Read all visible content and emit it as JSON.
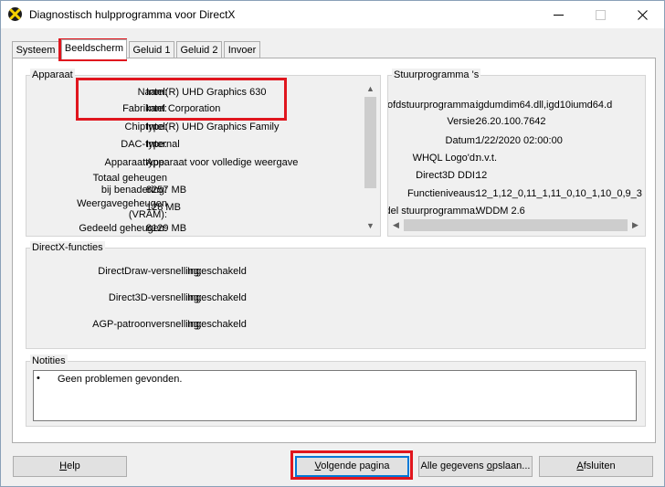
{
  "window": {
    "title": "Diagnostisch hulpprogramma voor DirectX",
    "icon": "directx-x-icon"
  },
  "tabs": [
    {
      "label": "Systeem",
      "active": false
    },
    {
      "label": "Beeldscherm",
      "active": true
    },
    {
      "label": "Geluid 1",
      "active": false
    },
    {
      "label": "Geluid 2",
      "active": false
    },
    {
      "label": "Invoer",
      "active": false
    }
  ],
  "device": {
    "title": "Apparaat",
    "rows": [
      {
        "label": "Naam:",
        "value": "Intel(R) UHD Graphics 630"
      },
      {
        "label": "Fabrikant:",
        "value": "Intel Corporation"
      },
      {
        "label": "Chiptype:",
        "value": "Intel(R) UHD Graphics Family"
      },
      {
        "label": "DAC-type:",
        "value": "Internal"
      },
      {
        "label": "Apparaattype:",
        "value": "Apparaat voor volledige weergave"
      },
      {
        "label_lines": [
          "Totaal geheugen",
          "bij benadering:"
        ],
        "value": "8257 MB"
      },
      {
        "label_lines": [
          "Weergavegeheugen",
          "(VRAM):"
        ],
        "value": "128 MB"
      },
      {
        "label": "Gedeeld geheugen:",
        "value": "8129 MB"
      }
    ]
  },
  "drivers": {
    "title": "Stuurprogramma 's",
    "rows": [
      {
        "label": "Hoofdstuurprogramma:",
        "value": "igdumdim64.dll,igd10iumd64.d"
      },
      {
        "label": "Versie:",
        "value": "26.20.100.7642"
      },
      {
        "label": "Datum:",
        "value": "1/22/2020 02:00:00"
      },
      {
        "label": "WHQL Logo'd:",
        "value": "n.v.t."
      },
      {
        "label": "Direct3D DDI:",
        "value": "12"
      },
      {
        "label": "Functieniveaus:",
        "value": "12_1,12_0,11_1,11_0,10_1,10_0,9_3"
      },
      {
        "label": "Model stuurprogramma:",
        "value": "WDDM 2.6"
      }
    ]
  },
  "directx": {
    "title": "DirectX-functies",
    "rows": [
      {
        "label": "DirectDraw-versnelling:",
        "value": "Ingeschakeld"
      },
      {
        "label": "Direct3D-versnelling:",
        "value": "Ingeschakeld"
      },
      {
        "label": "AGP-patroonversnelling:",
        "value": "Ingeschakeld"
      }
    ]
  },
  "notes": {
    "title": "Notities",
    "items": [
      "Geen problemen gevonden."
    ]
  },
  "buttons": {
    "help": {
      "pre": "",
      "ul": "H",
      "post": "elp"
    },
    "next": {
      "pre": "",
      "ul": "V",
      "post": "olgende pagina"
    },
    "save": {
      "pre": "Alle gegevens ",
      "ul": "o",
      "post": "pslaan..."
    },
    "exit": {
      "pre": "",
      "ul": "A",
      "post": "fsluiten"
    }
  },
  "colors": {
    "highlight": "#e0161e",
    "focus": "#0078d7"
  }
}
